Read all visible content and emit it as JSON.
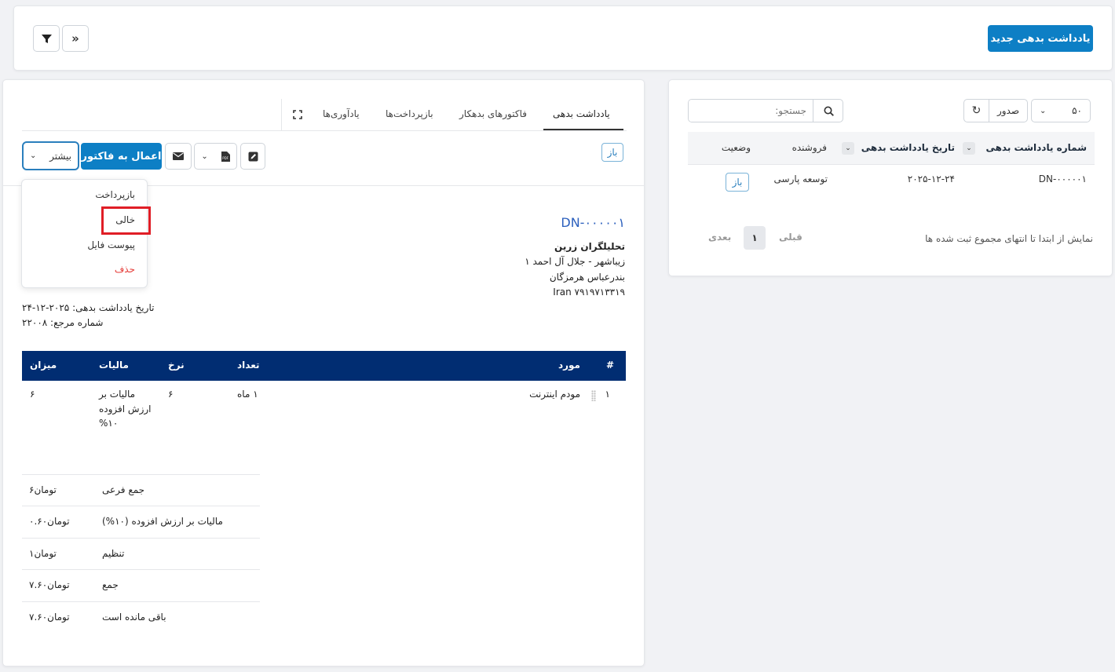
{
  "top_bar": {
    "new_button": "یادداشت بدهی جدید"
  },
  "list_panel": {
    "page_size": "۵۰",
    "export_label": "صدور",
    "search_placeholder": "جستجو:",
    "columns": {
      "number": "شماره یادداشت بدهی",
      "date": "تاریخ یادداشت بدهی",
      "vendor": "فروشنده",
      "status": "وضعیت"
    },
    "rows": [
      {
        "number": "DN-۰۰۰۰۰۱",
        "date": "۲۰۲۵-۱۲-۲۴",
        "vendor": "توسعه پارسی",
        "status": "باز"
      }
    ],
    "footer": {
      "info": "نمایش از ابتدا تا انتهای مجموع ثبت شده ها",
      "prev": "قبلی",
      "page": "۱",
      "next": "بعدی"
    }
  },
  "detail_panel": {
    "tabs": [
      "یادداشت بدهی",
      "فاکتورهای بدهکار",
      "بازپرداخت‌ها",
      "یادآوری‌ها"
    ],
    "status_badge": "باز",
    "apply_button": "اعمال به فاکتور",
    "more_button": "بیشتر",
    "menu": {
      "items": [
        "بازپرداخت",
        "خالی",
        "پیوست فایل",
        "حذف"
      ],
      "danger_color": "#e53935",
      "highlight_color": "#e01e26"
    },
    "doc": {
      "number": "DN-۰۰۰۰۰۱",
      "company": "تحلیلگران زرین",
      "address_1": "زیباشهر - جلال آل احمد ۱",
      "address_2": "بندرعباس هرمزگان",
      "address_3": "Iran ۷۹۱۹۷۱۳۳۱۹",
      "date_line": "تاریخ یادداشت بدهی: ۲۰۲۵-۱۲-۲۴",
      "ref_line": "شماره مرجع: ۲۲۰۰۸"
    },
    "items_table": {
      "header_color": "#012d72",
      "headers": {
        "index": "#",
        "item": "مورد",
        "qty": "تعداد",
        "rate": "نرخ",
        "tax": "مالیات",
        "amount": "میزان"
      },
      "rows": [
        {
          "index": "۱",
          "item": "مودم اینترنت",
          "qty": "۱ ماه",
          "rate": "۶",
          "tax_1": "مالیات بر",
          "tax_2": "ارزش افزوده",
          "tax_3": "%۱۰",
          "amount": "۶"
        }
      ]
    },
    "totals": [
      {
        "label": "جمع فرعی",
        "value": "۶تومان"
      },
      {
        "label": "مالیات بر ارزش افزوده (۱۰%)",
        "value": "۰.۶۰تومان"
      },
      {
        "label": "تنظیم",
        "value": "۱تومان"
      },
      {
        "label": "جمع",
        "value": "۷.۶۰تومان"
      },
      {
        "label": "باقی مانده است",
        "value": "۷.۶۰تومان"
      }
    ]
  }
}
